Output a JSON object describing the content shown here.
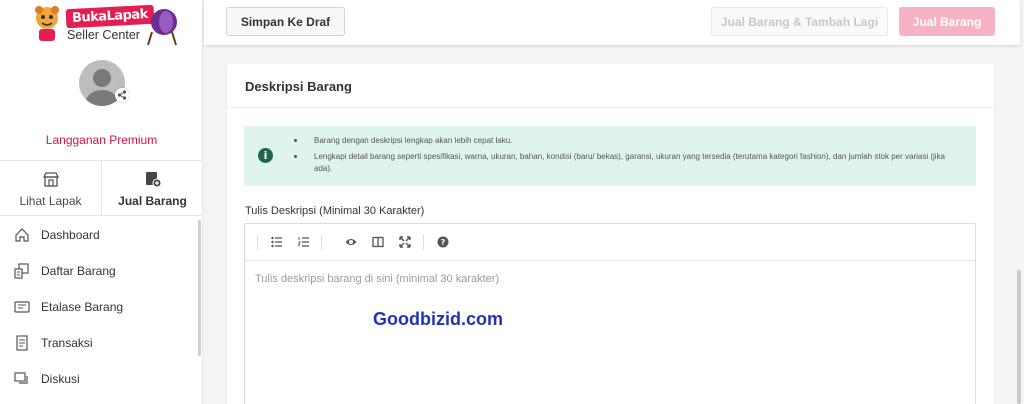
{
  "brand": {
    "name": "BukaLapak",
    "subtitle": "Seller Center"
  },
  "sidebar": {
    "subscription": "Langganan Premium",
    "tabs": [
      {
        "label": "Lihat Lapak",
        "icon": "store-icon"
      },
      {
        "label": "Jual Barang",
        "icon": "sell-item-icon"
      }
    ],
    "menu": [
      {
        "label": "Dashboard",
        "icon": "home-icon"
      },
      {
        "label": "Daftar Barang",
        "icon": "product-list-icon"
      },
      {
        "label": "Etalase Barang",
        "icon": "showcase-icon"
      },
      {
        "label": "Transaksi",
        "icon": "transaction-icon"
      },
      {
        "label": "Diskusi",
        "icon": "chat-icon"
      }
    ]
  },
  "actions": {
    "save_draft": "Simpan Ke Draf",
    "sell_and_add": "Jual Barang & Tambah Lagi",
    "sell": "Jual Barang"
  },
  "section": {
    "title": "Deskripsi Barang",
    "tips": [
      "Barang dengan deskripsi lengkap akan lebih cepat laku.",
      "Lengkapi detail barang seperti spesifikasi, warna, ukuran, bahan, kondisi (baru/ bekas), garansi, ukuran yang tersedia (terutama kategori fashion), dan jumlah stok per variasi (jika ada)."
    ],
    "field_label": "Tulis Deskripsi (Minimal 30 Karakter)",
    "placeholder": "Tulis deskripsi barang di sini (minimal 30 karakter)",
    "toolbar": [
      "bullet-list-icon",
      "numbered-list-icon",
      "preview-icon",
      "side-by-side-icon",
      "fullscreen-icon",
      "help-icon"
    ]
  },
  "watermark": "Goodbizid.com",
  "colors": {
    "brand": "#e31e52",
    "primary_disabled": "#f7b3c4",
    "info_bg": "#dff5ec",
    "info_icon": "#1f6650",
    "watermark": "#2132b8"
  }
}
